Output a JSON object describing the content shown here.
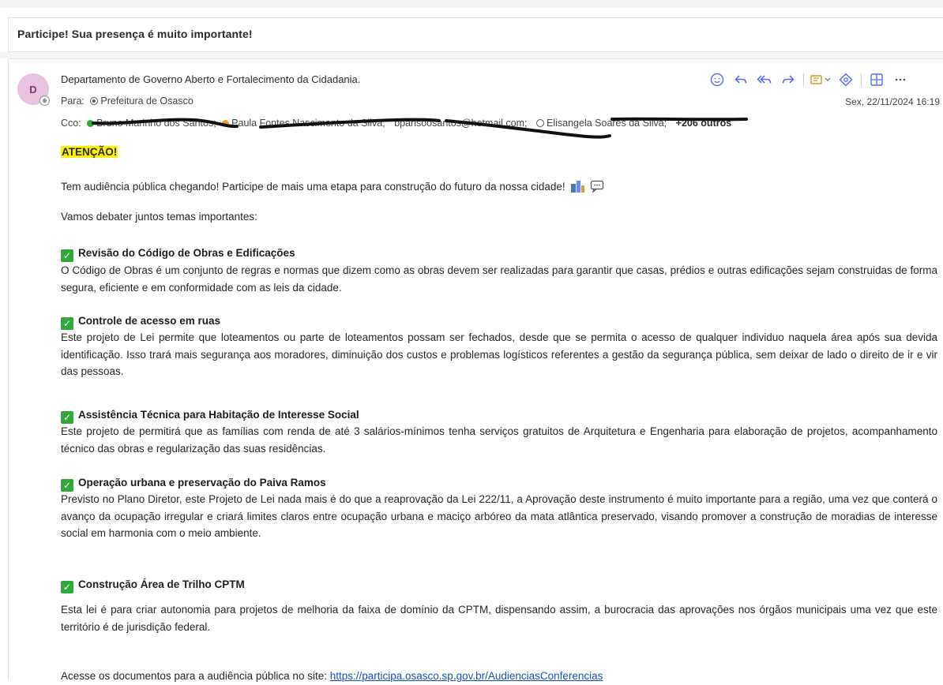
{
  "subject": "Participe! Sua presença é muito importante!",
  "header": {
    "avatar_initial": "D",
    "sender": "Departamento de Governo Aberto e Fortalecimento da Cidadania.",
    "to_label": "Para:",
    "to_value": "Prefeitura de Osasco",
    "date": "Sex, 22/11/2024 16:19",
    "cc_label": "Cco:",
    "cc_entries": [
      "Bruno Marinho dos Santos;",
      "Paula Fontes Nascimento da Silva;",
      "bparisoosantos@hotmail.com;",
      "Elisangela Soares da Silva;"
    ],
    "cc_more": "+206 outros",
    "cc_dot_colors": [
      "#2fa83a",
      "#f0a020"
    ]
  },
  "toolbar": {
    "icons": [
      "emoji-icon",
      "reply-icon",
      "reply-all-icon",
      "forward-icon",
      "apps-icon",
      "immersive-reader-icon",
      "grid-view-icon",
      "more-icon"
    ],
    "accent": "#4f6bed"
  },
  "body": {
    "attention": "ATENÇÃO!",
    "intro": "Tem audiência pública chegando! Participe de mais uma etapa para construção do futuro da nossa cidade!",
    "debate": "Vamos debater juntos temas importantes:",
    "topics": [
      {
        "title": "Revisão do Código de Obras e Edificações",
        "text": "O Código de Obras é um conjunto de regras e normas que dizem como as obras devem ser realizadas para garantir que casas, prédios e outras edificações sejam construidas de forma segura, eficiente e em conformidade com as leis da cidade."
      },
      {
        "title": "Controle de acesso em ruas",
        "text": "Este projeto de Lei permite que loteamentos ou parte de loteamentos possam ser fechados, desde que se permita o acesso de qualquer individuo naquela área após sua devida identificação. Isso trará mais segurança aos moradores, diminuição dos custos e problemas logísticos referentes a gestão da segurança pública, sem deixar de lado o direito de ir e vir das pessoas."
      },
      {
        "title": "Assistência Técnica para Habitação de Interesse Social",
        "text": "Este projeto de permitirá que as famílias com renda de até 3 salários-mínimos tenha serviços gratuitos de Arquitetura e Engenharia para elaboração de projetos, acompanhamento técnico das obras e regularização das suas residências."
      },
      {
        "title": "Operação urbana e preservação do Paiva Ramos",
        "text": "Previsto no Plano Diretor, este Projeto de Lei nada mais é do que a reaprovação da Lei 222/11, a Aprovação deste instrumento é muito importante para a região, uma vez que conterá o avanço da ocupação irregular e criará limites claros entre ocupação urbana e maciço arbóreo da mata atlântica preservado, visando promover a construção de moradias de interesse social em harmonia com o meio ambiente."
      },
      {
        "title": "Construção Área de Trilho CPTM",
        "text": "Esta lei é para criar autonomia para projetos de melhoria da faixa de domínio da CPTM, dispensando assim, a burocracia das aprovações nos órgãos municipais uma vez que este território é de jurisdição federal."
      }
    ],
    "site_prefix": "Acesse os documentos para a audiência pública no site:",
    "site_link": "https://participa.osasco.sp.gov.br/AudienciasConferencias"
  }
}
